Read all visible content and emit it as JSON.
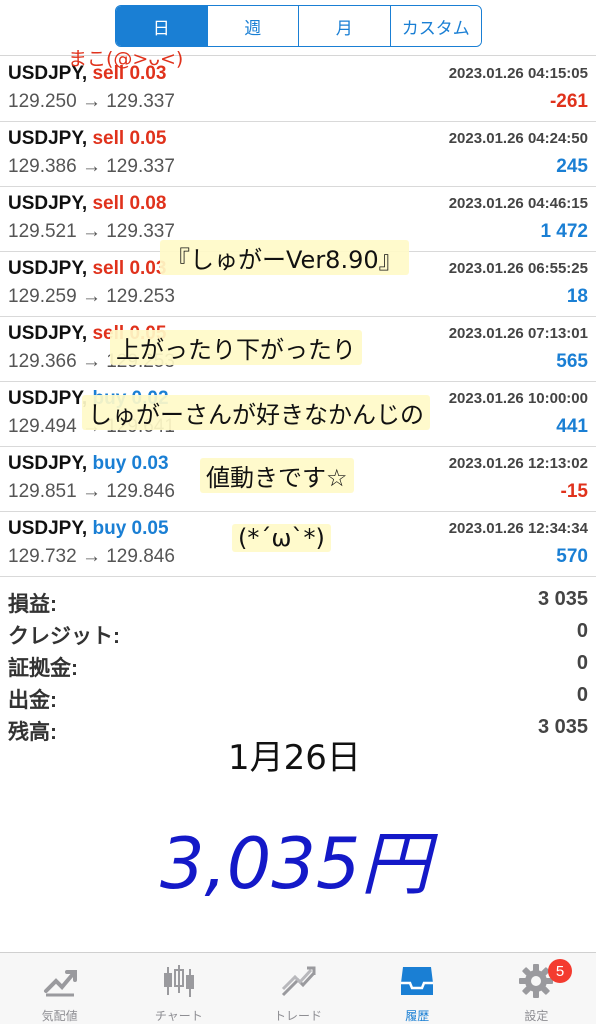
{
  "segments": [
    {
      "label": "日",
      "active": true
    },
    {
      "label": "週",
      "active": false
    },
    {
      "label": "月",
      "active": false
    },
    {
      "label": "カスタム",
      "active": false
    }
  ],
  "trades": [
    {
      "symbol": "USDJPY,",
      "side": "sell",
      "side_label": "sell 0.03",
      "time": "2023.01.26 04:15:05",
      "prices": "129.250 → 129.337",
      "profit": "-261"
    },
    {
      "symbol": "USDJPY,",
      "side": "sell",
      "side_label": "sell 0.05",
      "time": "2023.01.26 04:24:50",
      "prices": "129.386 → 129.337",
      "profit": "245"
    },
    {
      "symbol": "USDJPY,",
      "side": "sell",
      "side_label": "sell 0.08",
      "time": "2023.01.26 04:46:15",
      "prices": "129.521 → 129.337",
      "profit": "1 472"
    },
    {
      "symbol": "USDJPY,",
      "side": "sell",
      "side_label": "sell 0.03",
      "time": "2023.01.26 06:55:25",
      "prices": "129.259 → 129.253",
      "profit": "18"
    },
    {
      "symbol": "USDJPY,",
      "side": "sell",
      "side_label": "sell 0.05",
      "time": "2023.01.26 07:13:01",
      "prices": "129.366 → 129.253",
      "profit": "565"
    },
    {
      "symbol": "USDJPY,",
      "side": "buy",
      "side_label": "buy 0.02",
      "time": "2023.01.26 10:00:00",
      "prices": "129.494 → 129.641",
      "profit": "441"
    },
    {
      "symbol": "USDJPY,",
      "side": "buy",
      "side_label": "buy 0.03",
      "time": "2023.01.26 12:13:02",
      "prices": "129.851 → 129.846",
      "profit": "-15"
    },
    {
      "symbol": "USDJPY,",
      "side": "buy",
      "side_label": "buy 0.05",
      "time": "2023.01.26 12:34:34",
      "prices": "129.732 → 129.846",
      "profit": "570"
    }
  ],
  "summary": [
    {
      "label": "損益:",
      "value": "3 035"
    },
    {
      "label": "クレジット:",
      "value": "0"
    },
    {
      "label": "証拠金:",
      "value": "0"
    },
    {
      "label": "出金:",
      "value": "0"
    },
    {
      "label": "残高:",
      "value": "3 035"
    }
  ],
  "handwriting": {
    "signature": "まこ(@>ᴗ<)",
    "title": "『しゅがーVer8.90』",
    "line1": "上がったり下がったり",
    "line2": "しゅがーさんが好きなかんじの",
    "line3": "値動きです☆",
    "face": "(*´ω`*)",
    "date": "1月26日",
    "total": "3,035円"
  },
  "tabs": [
    {
      "label": "気配値",
      "icon": "quotes-icon",
      "active": false
    },
    {
      "label": "チャート",
      "icon": "candlestick-chart-icon",
      "active": false
    },
    {
      "label": "トレード",
      "icon": "trade-trend-icon",
      "active": false
    },
    {
      "label": "履歴",
      "icon": "history-inbox-icon",
      "active": true
    },
    {
      "label": "設定",
      "icon": "settings-gear-icon",
      "active": false,
      "badge": "5"
    }
  ],
  "colors": {
    "accent": "#1a7fd4",
    "sell": "#e0321c",
    "buy": "#1a7fd4",
    "loss": "#e0321c",
    "gain": "#1a7fd4",
    "handwriting_total": "#1419c8",
    "badge": "#f43b2f"
  }
}
